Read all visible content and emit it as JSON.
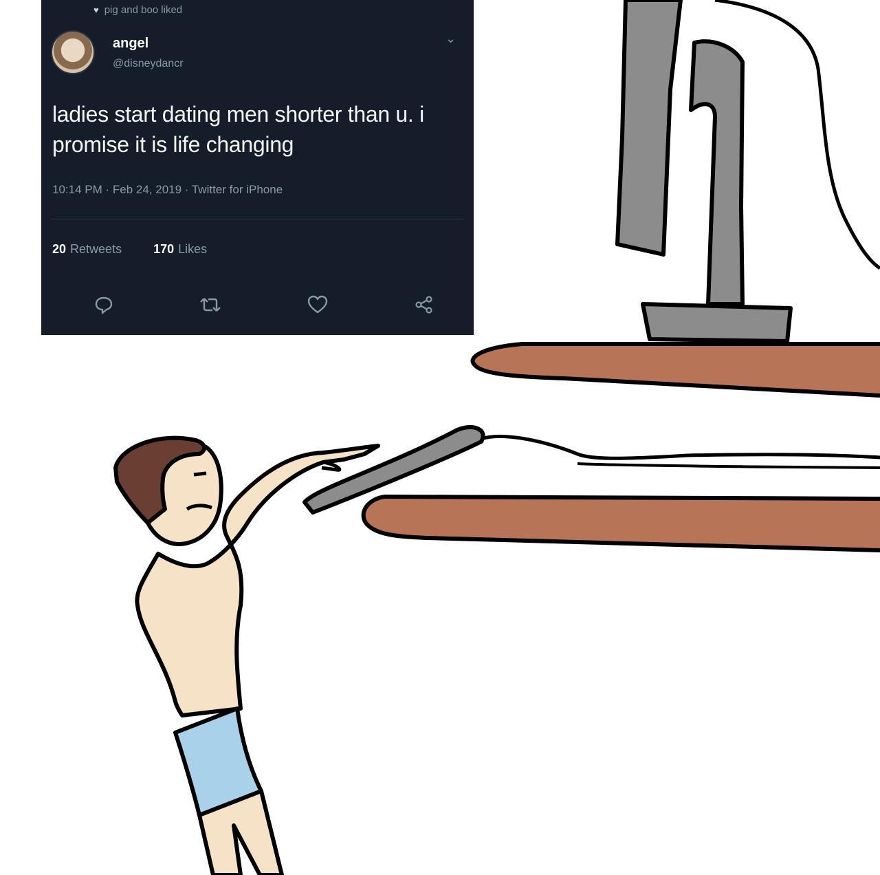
{
  "tweet": {
    "liked_by": "pig and boo liked",
    "name": "angel",
    "handle": "@disneydancr",
    "text": "ladies start dating men shorter than u. i promise it is life changing",
    "timestamp": "10:14 PM · Feb 24, 2019 · Twitter for iPhone",
    "retweets_count": "20",
    "retweets_label": "Retweets",
    "likes_count": "170",
    "likes_label": "Likes",
    "actions": [
      "reply-icon",
      "retweet-icon",
      "like-icon",
      "share-icon"
    ]
  },
  "colors": {
    "tweet_bg": "#141d29",
    "desk": "#b87456",
    "monitor": "#8c8c8c",
    "skin": "#f6e2c7",
    "hair": "#6a3e33",
    "shorts": "#a9d2ea"
  }
}
